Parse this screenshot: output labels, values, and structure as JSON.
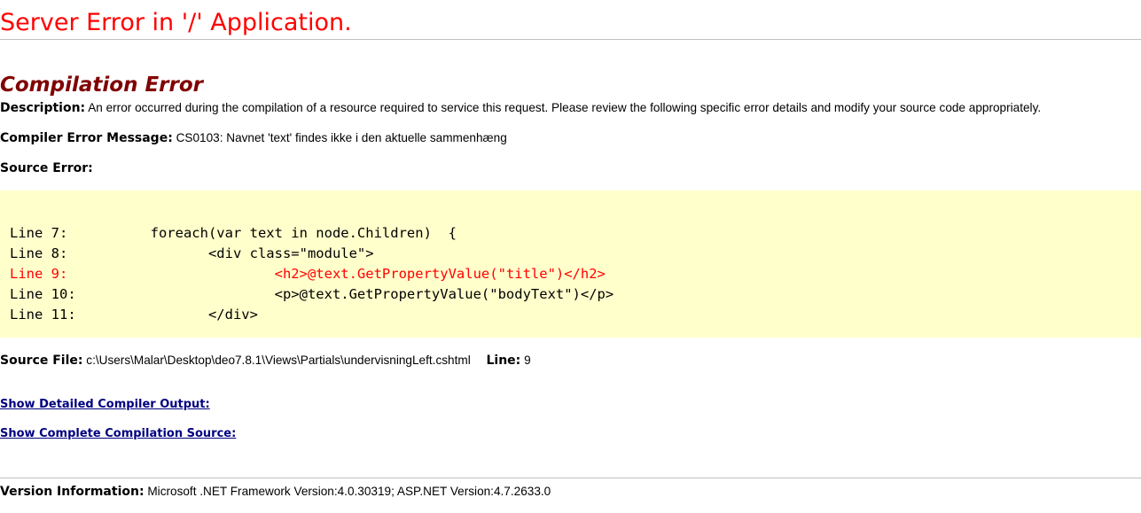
{
  "page": {
    "title": "Server Error in '/' Application.",
    "section_title": "Compilation Error"
  },
  "description": {
    "label": "Description:",
    "text": "An error occurred during the compilation of a resource required to service this request. Please review the following specific error details and modify your source code appropriately."
  },
  "compiler_error": {
    "label": "Compiler Error Message:",
    "text": "CS0103: Navnet 'text' findes ikke i den aktuelle sammenhæng"
  },
  "source_error": {
    "label": "Source Error:",
    "lines": [
      {
        "text": "Line 7:          foreach(var text in node.Children)  {",
        "error": false
      },
      {
        "text": "Line 8:                 <div class=\"module\">",
        "error": false
      },
      {
        "text": "Line 9:                         <h2>@text.GetPropertyValue(\"title\")</h2>",
        "error": true
      },
      {
        "text": "Line 10:                        <p>@text.GetPropertyValue(\"bodyText\")</p>",
        "error": false
      },
      {
        "text": "Line 11:                </div>",
        "error": false
      }
    ]
  },
  "source_file": {
    "label": "Source File:",
    "path": "c:\\Users\\Malar\\Desktop\\deo7.8.1\\Views\\Partials\\undervisningLeft.cshtml",
    "line_label": "Line:",
    "line_number": "9"
  },
  "links": {
    "detailed_output": "Show Detailed Compiler Output:",
    "complete_source": "Show Complete Compilation Source:"
  },
  "version": {
    "label": "Version Information:",
    "text": "Microsoft .NET Framework Version:4.0.30319; ASP.NET Version:4.7.2633.0"
  },
  "colors": {
    "title": "#ff0000",
    "section_title": "#800000",
    "code_background": "#ffffcc",
    "error_line": "#ff0000",
    "link": "#000080"
  }
}
